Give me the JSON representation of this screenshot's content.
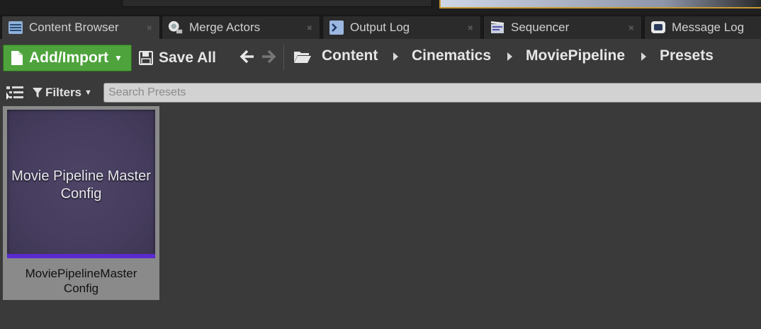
{
  "tabs": [
    {
      "label": "Content Browser",
      "icon": "content-browser-icon",
      "active": true
    },
    {
      "label": "Merge Actors",
      "icon": "merge-actors-icon",
      "active": false
    },
    {
      "label": "Output Log",
      "icon": "output-log-icon",
      "active": false
    },
    {
      "label": "Sequencer",
      "icon": "sequencer-icon",
      "active": false
    },
    {
      "label": "Message Log",
      "icon": "message-log-icon",
      "active": false
    }
  ],
  "toolbar": {
    "add_import_label": "Add/Import",
    "save_all_label": "Save All",
    "back_icon": "back-arrow-icon",
    "forward_icon": "forward-arrow-icon",
    "add_color": "#4ea33c"
  },
  "breadcrumb": [
    "Content",
    "Cinematics",
    "MoviePipeline",
    "Presets"
  ],
  "filter": {
    "filters_label": "Filters",
    "search_placeholder": "Search Presets"
  },
  "assets": [
    {
      "thumbnail_text_line1": "Movie Pipeline Master",
      "thumbnail_text_line2": "Config",
      "name_line1": "MoviePipelineMaster",
      "name_line2": "Config",
      "type_color": "#5a2ad0"
    }
  ]
}
